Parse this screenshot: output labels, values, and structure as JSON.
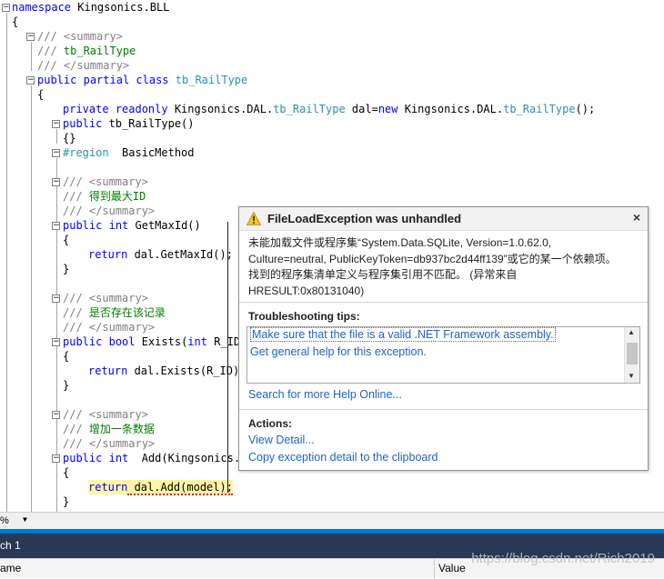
{
  "code": {
    "namespace_kw": "namespace",
    "namespace_name": " Kingsonics.BLL",
    "open_brace": "{",
    "summary_open": "/// <summary>",
    "summary_close": "/// </summary>",
    "triple_slash": "/// ",
    "class_summary": "tb_RailType",
    "public_kw": "public",
    "partial_kw": "partial",
    "class_kw": "class",
    "class_name": "tb_RailType",
    "private_kw": "private",
    "readonly_kw": "readonly",
    "dal_ns": " Kingsonics.DAL.",
    "dal_type": "tb_RailType",
    "dal_var": " dal=",
    "new_kw": "new",
    "dal_ns2": " Kingsonics.DAL.",
    "dal_type2": "tb_RailType",
    "dal_tail": "();",
    "ctor": " tb_RailType()",
    "ctor_body": "{}",
    "region_kw": "#region",
    "region_name": "  BasicMethod",
    "getmax_summary": "得到最大ID",
    "int_kw": "int",
    "getmax_sig": " GetMaxId()",
    "lbrace": "{",
    "rbrace": "}",
    "return_kw": "return",
    "getmax_body": " dal.GetMaxId();",
    "exists_summary": "是否存在该记录",
    "bool_kw": "bool",
    "exists_sig_a": " Exists(",
    "exists_sig_b": " R_ID)",
    "exists_body": " dal.Exists(R_ID)",
    "add_summary": "增加一条数据",
    "add_sig": "  Add(Kingsonics.M",
    "add_body": " dal.Add(model);"
  },
  "zoom": "%",
  "panel": {
    "title": "ch 1",
    "col_name": "ame",
    "col_value": "Value"
  },
  "watermark": "https://blog.csdn.net/Rich2019",
  "exception": {
    "title": "FileLoadException was unhandled",
    "close": "×",
    "message": "未能加载文件或程序集“System.Data.SQLite, Version=1.0.62.0, Culture=neutral, PublicKeyToken=db937bc2d44ff139”或它的某一个依赖项。找到的程序集清单定义与程序集引用不匹配。 (异常来自 HRESULT:0x80131040)",
    "tips_label": "Troubleshooting tips:",
    "tips": [
      "Make sure that the file is a valid .NET Framework assembly.",
      "Get general help for this exception."
    ],
    "search_link": "Search for more Help Online...",
    "actions_label": "Actions:",
    "actions": [
      "View Detail...",
      "Copy exception detail to the clipboard"
    ]
  },
  "colors": {
    "keyword": "#0000ff",
    "comment": "#008000",
    "type": "#2b91af",
    "link": "#1e63c6",
    "accent": "#007acc"
  }
}
